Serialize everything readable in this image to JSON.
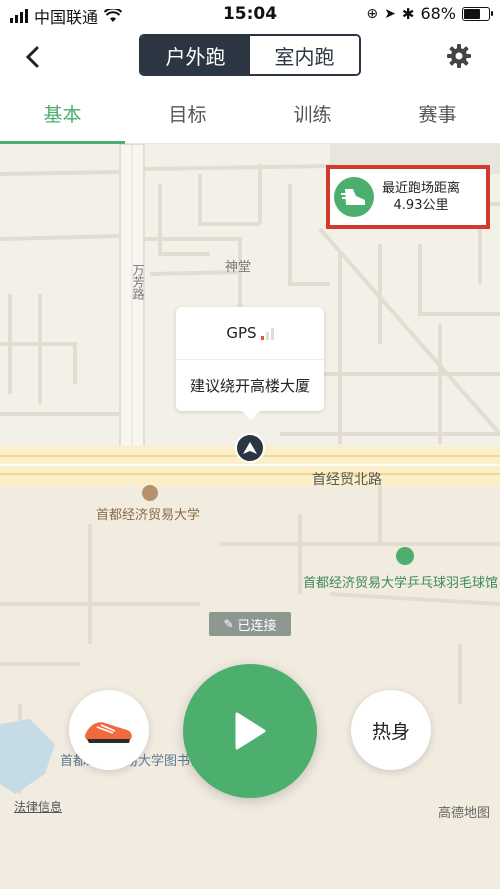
{
  "status_bar": {
    "carrier": "中国联通",
    "time": "15:04",
    "battery_percent": "68%",
    "battery_level": 0.68
  },
  "nav": {
    "segments": [
      {
        "label": "户外跑",
        "active": true
      },
      {
        "label": "室内跑",
        "active": false
      }
    ]
  },
  "tabs": [
    {
      "label": "基本",
      "active": true
    },
    {
      "label": "目标",
      "active": false
    },
    {
      "label": "训练",
      "active": false
    },
    {
      "label": "赛事",
      "active": false
    }
  ],
  "map": {
    "labels": {
      "road_wanfang": "万芳路",
      "shentang": "神堂",
      "road_shoujingmao": "首经贸北路",
      "university": "首都经济贸易大学",
      "sports": "首都经济贸易大学乒乓球羽毛球馆",
      "library": "首都经济贸易大学图书馆"
    },
    "nearest_track": {
      "title": "最近跑场距离",
      "distance": "4.93公里"
    },
    "gps": {
      "label": "GPS",
      "tip": "建议绕开高楼大厦"
    },
    "connected": "已连接",
    "legal": "法律信息",
    "provider": "高德地图"
  },
  "actions": {
    "warmup": "热身"
  },
  "colors": {
    "accent": "#4caf6e",
    "dark": "#2b3642",
    "highlight_border": "#d23a2d"
  }
}
